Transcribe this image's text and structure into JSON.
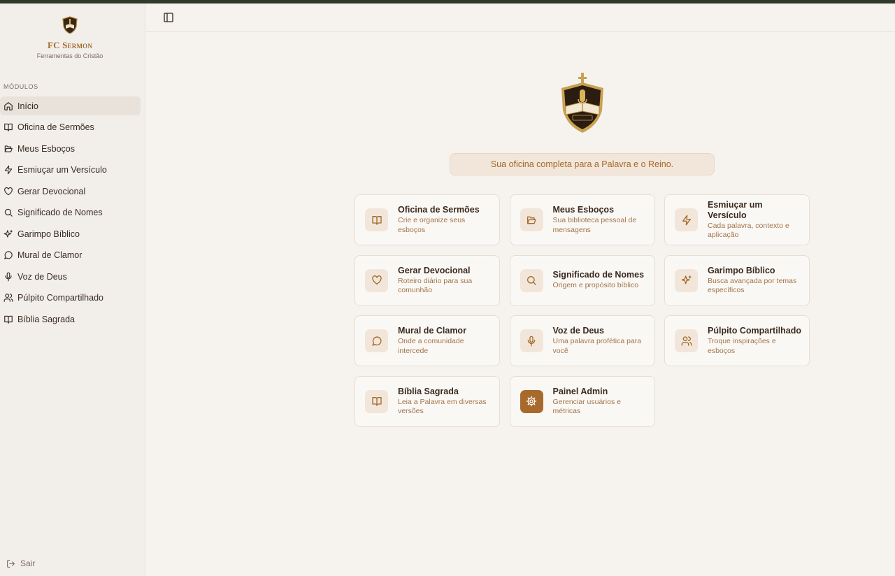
{
  "brand": {
    "title": "FC Sermon",
    "subtitle": "Ferramentas do Cristão"
  },
  "sidebar": {
    "section_label": "MÓDULOS",
    "items": [
      {
        "label": "Início",
        "icon": "home-icon"
      },
      {
        "label": "Oficina de Sermões",
        "icon": "book-open-icon"
      },
      {
        "label": "Meus Esboços",
        "icon": "folder-open-icon"
      },
      {
        "label": "Esmiuçar um Versículo",
        "icon": "zap-icon"
      },
      {
        "label": "Gerar Devocional",
        "icon": "heart-icon"
      },
      {
        "label": "Significado de Nomes",
        "icon": "search-icon"
      },
      {
        "label": "Garimpo Bíblico",
        "icon": "sparkles-icon"
      },
      {
        "label": "Mural de Clamor",
        "icon": "message-circle-icon"
      },
      {
        "label": "Voz de Deus",
        "icon": "mic-icon"
      },
      {
        "label": "Púlpito Compartilhado",
        "icon": "users-icon"
      },
      {
        "label": "Bíblia Sagrada",
        "icon": "book-open-icon"
      }
    ],
    "logout_label": "Sair"
  },
  "main": {
    "tagline": "Sua oficina completa para a Palavra e o Reino.",
    "cards": [
      {
        "title": "Oficina de Sermões",
        "desc": "Crie e organize seus esboços",
        "icon": "book-open-icon"
      },
      {
        "title": "Meus Esboços",
        "desc": "Sua biblioteca pessoal de mensagens",
        "icon": "folder-open-icon"
      },
      {
        "title": "Esmiuçar um Versículo",
        "desc": "Cada palavra, contexto e aplicação",
        "icon": "zap-icon"
      },
      {
        "title": "Gerar Devocional",
        "desc": "Roteiro diário para sua comunhão",
        "icon": "heart-icon"
      },
      {
        "title": "Significado de Nomes",
        "desc": "Origem e propósito bíblico",
        "icon": "search-icon"
      },
      {
        "title": "Garimpo Bíblico",
        "desc": "Busca avançada por temas específicos",
        "icon": "sparkles-icon"
      },
      {
        "title": "Mural de Clamor",
        "desc": "Onde a comunidade intercede",
        "icon": "message-circle-icon"
      },
      {
        "title": "Voz de Deus",
        "desc": "Uma palavra profética para você",
        "icon": "mic-icon"
      },
      {
        "title": "Púlpito Compartilhado",
        "desc": "Troque inspirações e esboços",
        "icon": "users-icon"
      },
      {
        "title": "Bíblia Sagrada",
        "desc": "Leia a Palavra em diversas versões",
        "icon": "book-open-icon"
      },
      {
        "title": "Painel Admin",
        "desc": "Gerenciar usuários e métricas",
        "icon": "settings-icon"
      }
    ]
  },
  "colors": {
    "accent": "#a26a2a",
    "admin_accent": "#a8692c",
    "topbar": "#2f3a2a",
    "active_nav_bg": "#e8e2da"
  }
}
